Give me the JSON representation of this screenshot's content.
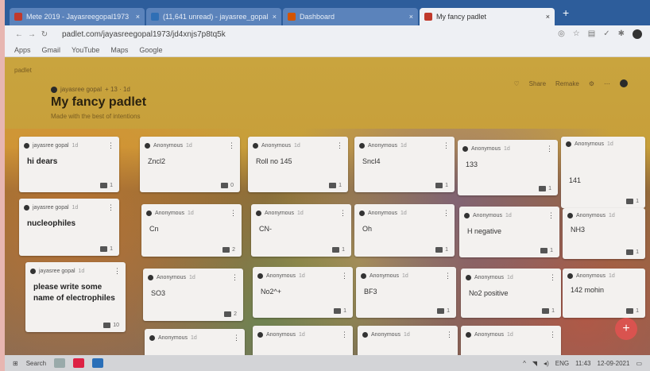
{
  "browser": {
    "tabs": [
      {
        "label": "Mete 2019 - Jayasreegopal1973",
        "favicon_color": "#c0392b",
        "active": false
      },
      {
        "label": "(11,641 unread) - jayasree_gopal",
        "favicon_color": "#2f6fb5",
        "active": false
      },
      {
        "label": "Dashboard",
        "favicon_color": "#d35400",
        "active": false
      },
      {
        "label": "My fancy padlet",
        "favicon_color": "#c0392b",
        "active": true
      }
    ],
    "new_tab_label": "+",
    "url": "padlet.com/jayasreegopal1973/jd4xnjs7p8tq5k",
    "bookmarks": [
      "Apps",
      "Gmail",
      "YouTube",
      "Maps",
      "Google"
    ]
  },
  "board": {
    "brand": "padlet",
    "author": "jayasree gopal",
    "author_meta": "+ 13 · 1d",
    "title": "My fancy padlet",
    "subtitle": "Made with the best of intentions",
    "actions": [
      "Share",
      "Remake"
    ],
    "fab_label": "+"
  },
  "columns": [
    {
      "header": {
        "author": "jayasree gopal",
        "time": "1d",
        "text": "hi dears",
        "comments": "1"
      },
      "posts": []
    },
    {
      "header": {
        "author": "Anonymous",
        "time": "1d",
        "text": "Zncl2",
        "comments": "0"
      },
      "posts": [
        {
          "author": "Anonymous",
          "time": "1d",
          "text": "Cn",
          "comments": "2"
        },
        {
          "author": "Anonymous",
          "time": "1d",
          "text": "SO3",
          "comments": "2"
        },
        {
          "author": "Anonymous",
          "time": "1d",
          "text": ""
        }
      ]
    },
    {
      "header": {
        "author": "Anonymous",
        "time": "1d",
        "text": "Roll no 145",
        "comments": "1"
      },
      "posts": [
        {
          "author": "Anonymous",
          "time": "1d",
          "text": "CN-",
          "comments": "1"
        },
        {
          "author": "Anonymous",
          "time": "1d",
          "text": "No2^+",
          "comments": "1"
        },
        {
          "author": "Anonymous",
          "time": "1d",
          "text": ""
        }
      ]
    },
    {
      "header": {
        "author": "Anonymous",
        "time": "1d",
        "text": "Sncl4",
        "comments": "1"
      },
      "posts": [
        {
          "author": "Anonymous",
          "time": "1d",
          "text": "Oh",
          "comments": "1"
        },
        {
          "author": "Anonymous",
          "time": "1d",
          "text": "BF3",
          "comments": "1"
        },
        {
          "author": "Anonymous",
          "time": "1d",
          "text": ""
        }
      ]
    },
    {
      "header": {
        "author": "Anonymous",
        "time": "1d",
        "text": "133",
        "comments": "1"
      },
      "posts": [
        {
          "author": "Anonymous",
          "time": "1d",
          "text": "H negative",
          "comments": "1"
        },
        {
          "author": "Anonymous",
          "time": "1d",
          "text": "No2 positive",
          "comments": "1"
        },
        {
          "author": "Anonymous",
          "time": "1d",
          "text": ""
        }
      ]
    },
    {
      "header": {
        "author": "Anonymous",
        "time": "1d",
        "text": "141",
        "comments": "1"
      },
      "posts": [
        {
          "author": "Anonymous",
          "time": "1d",
          "text": "NH3",
          "comments": "1"
        },
        {
          "author": "Anonymous",
          "time": "1d",
          "text": "142 mohin",
          "comments": "1"
        }
      ]
    }
  ],
  "section_headers": [
    {
      "author": "jayasree gopal",
      "time": "1d",
      "text": "nucleophiles",
      "comments": "1"
    },
    {
      "author": "jayasree gopal",
      "time": "1d",
      "text": "please write some name of electrophiles",
      "comments": "10"
    }
  ],
  "taskbar": {
    "search_label": "Search",
    "lang": "ENG",
    "time": "11:43",
    "date": "12-09-2021"
  }
}
